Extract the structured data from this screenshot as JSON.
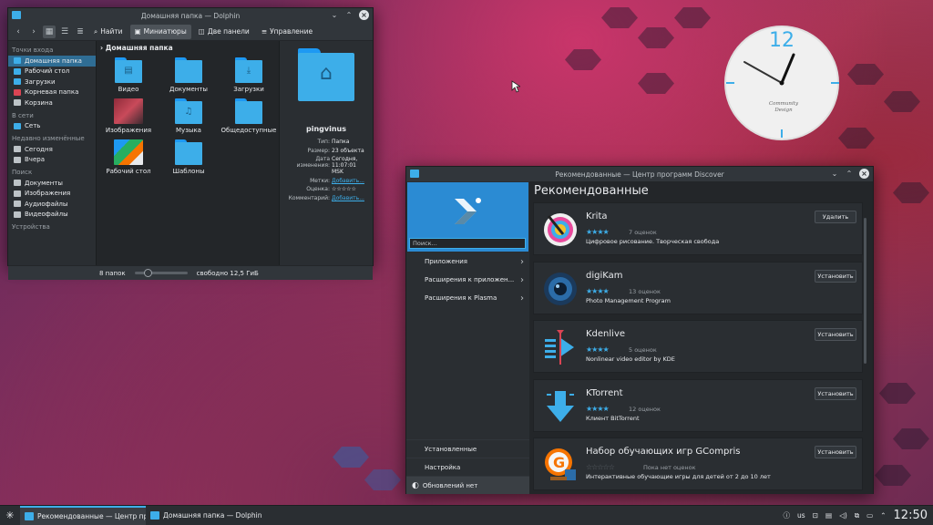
{
  "dolphin": {
    "title": "Домашняя папка — Dolphin",
    "toolbar": {
      "find": "Найти",
      "thumbnails": "Миниатюры",
      "split": "Две панели",
      "control": "Управление"
    },
    "sidebar": {
      "places_header": "Точки входа",
      "places": [
        "Домашняя папка",
        "Рабочий стол",
        "Загрузки",
        "Корневая папка",
        "Корзина"
      ],
      "network_header": "В сети",
      "network": [
        "Сеть"
      ],
      "recent_header": "Недавно изменённые",
      "recent": [
        "Сегодня",
        "Вчера"
      ],
      "search_header": "Поиск",
      "search": [
        "Документы",
        "Изображения",
        "Аудиофайлы",
        "Видеофайлы"
      ],
      "devices_header": "Устройства"
    },
    "breadcrumb": "Домашняя папка",
    "items": [
      "Видео",
      "Документы",
      "Загрузки",
      "Изображения",
      "Музыка",
      "Общедоступные",
      "Рабочий стол",
      "Шаблоны"
    ],
    "info": {
      "name": "pingvinus",
      "type_label": "Тип:",
      "type": "Папка",
      "size_label": "Размер:",
      "size": "23 объекта",
      "modified_label": "Дата изменения:",
      "modified": "Сегодня, 11:07:01 MSK",
      "tags_label": "Метки:",
      "tags": "Добавить...",
      "rating_label": "Оценка:",
      "rating": "☆☆☆☆☆",
      "comment_label": "Комментарий:",
      "comment": "Добавить..."
    },
    "status": {
      "count": "8 папок",
      "free": "свободно 12,5 ГиБ"
    }
  },
  "discover": {
    "title": "Рекомендованные — Центр программ Discover",
    "search_placeholder": "Поиск...",
    "categories": [
      "Приложения",
      "Расширения к приложен...",
      "Расширения к Plasma"
    ],
    "bottom": {
      "installed": "Установленные",
      "settings": "Настройка",
      "updates": "Обновлений нет"
    },
    "heading": "Рекомендованные",
    "apps": [
      {
        "name": "Krita",
        "stars": "★★★★",
        "rating": "7 оценок",
        "desc": "Цифровое рисование. Творческая свобода",
        "button": "Удалить"
      },
      {
        "name": "digiKam",
        "stars": "★★★★",
        "rating": "13 оценок",
        "desc": "Photo Management Program",
        "button": "Установить"
      },
      {
        "name": "Kdenlive",
        "stars": "★★★★",
        "rating": "5 оценок",
        "desc": "Nonlinear video editor by KDE",
        "button": "Установить"
      },
      {
        "name": "KTorrent",
        "stars": "★★★★",
        "rating": "12 оценок",
        "desc": "Клиент BitTorrent",
        "button": "Установить"
      },
      {
        "name": "Набор обучающих игр GCompris",
        "stars": "☆☆☆☆☆",
        "rating": "Пока нет оценок",
        "desc": "Интерактивные обучающие игры для детей от 2 до 10 лет",
        "button": "Установить"
      }
    ]
  },
  "clock_widget": {
    "number": "12",
    "brand_line1": "Community",
    "brand_line2": "Design"
  },
  "taskbar": {
    "tasks": [
      "Рекомендованные — Центр прог...",
      "Домашняя папка — Dolphin"
    ],
    "layout": "us",
    "time": "12:50"
  },
  "colors": {
    "accent": "#3daee9",
    "window_bg": "#2a2e32",
    "selection": "#2f6d94"
  }
}
